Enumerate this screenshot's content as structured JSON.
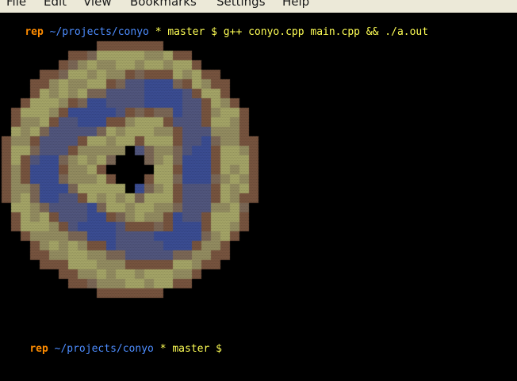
{
  "menubar": {
    "items": [
      "File",
      "Edit",
      "View",
      "Bookmarks",
      "Settings",
      "Help"
    ]
  },
  "prompt1": {
    "user": "rep",
    "path": "~/projects/conyo",
    "star": "*",
    "branch": "master",
    "dollar": "$",
    "command": "g++ conyo.cpp main.cpp && ./a.out"
  },
  "prompt2": {
    "user": "rep",
    "path": "~/projects/conyo",
    "star": "*",
    "branch": "master",
    "dollar": "$"
  },
  "colors": {
    "background": "#000000",
    "user": "#ff8c00",
    "path": "#4d8dff",
    "branch": "#ffff55",
    "donut_outer": "#7a5640",
    "donut_light": "#a8a86a",
    "donut_blue": "#3c4f96",
    "donut_mid": "#7e6a58"
  },
  "donut": {
    "description_icon": "ascii-donut-render",
    "radii_cells": {
      "outer": 13.6,
      "hole": 2.1
    },
    "grid_size_cells": 27
  }
}
